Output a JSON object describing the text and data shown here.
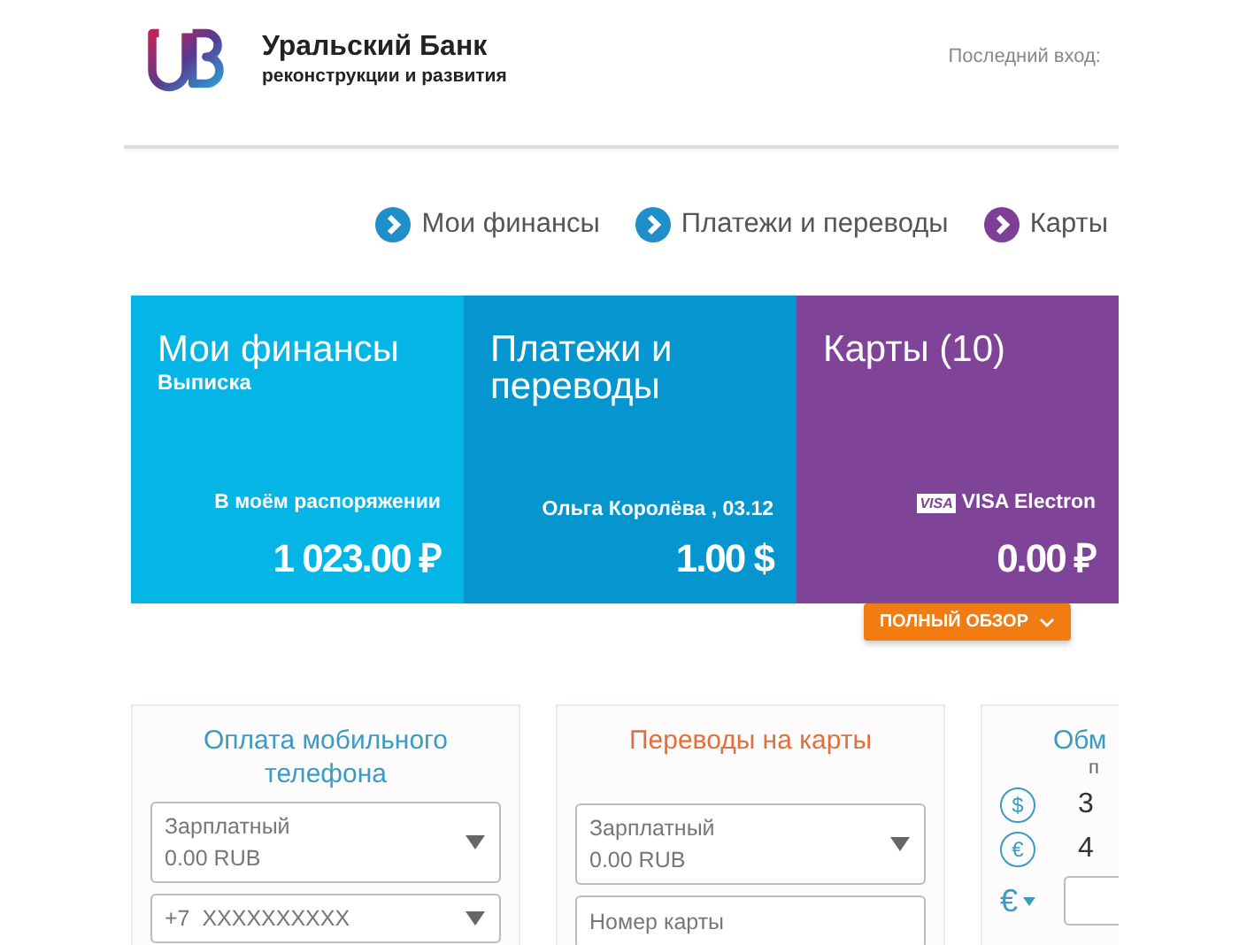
{
  "header": {
    "bank_name": "Уральский Банк",
    "bank_subtitle": "реконструкции и развития",
    "last_login_label": "Последний вход:"
  },
  "nav": [
    {
      "label": "Мои финансы",
      "color": "#1e8fc8"
    },
    {
      "label": "Платежи и переводы",
      "color": "#1e8fc8"
    },
    {
      "label": "Карты",
      "color": "#7d3f98"
    }
  ],
  "tiles": [
    {
      "title": "Мои финансы",
      "subtitle": "Выписка",
      "caption": "В моём распоряжении",
      "amount": "1 023.00 ₽",
      "color": "#05b5e6"
    },
    {
      "title": "Платежи и переводы",
      "caption": "Ольга Королёва , 03.12",
      "amount": "1.00 $",
      "color": "#0596cf"
    },
    {
      "title": "Карты (10)",
      "card_badge": "VISA",
      "caption": "VISA Electron",
      "amount": "0.00 ₽",
      "color": "#7f4397"
    }
  ],
  "overview_button": "ПОЛНЫЙ ОБЗОР",
  "widgets": [
    {
      "title": "Оплата мобильного телефона",
      "color": "#3a9bc4",
      "kind": "form",
      "fields": [
        {
          "kind": "select",
          "lines": [
            "Зарплатный",
            "0.00 RUB"
          ]
        },
        {
          "kind": "select",
          "lines": [
            "+7  XXXXXXXXXX"
          ]
        }
      ]
    },
    {
      "title": "Переводы на карты",
      "color": "#e0703c",
      "kind": "form",
      "fields": [
        {
          "kind": "select",
          "lines": [
            "Зарплатный",
            "0.00 RUB"
          ]
        },
        {
          "kind": "input",
          "placeholder": "Номер карты"
        }
      ]
    },
    {
      "title": "Обм",
      "color": "#3a9bc4",
      "kind": "rates",
      "column_label": "п",
      "rates": [
        {
          "symbol": "$",
          "value": "3"
        },
        {
          "symbol": "€",
          "value": "4"
        }
      ],
      "currency": "€"
    }
  ]
}
